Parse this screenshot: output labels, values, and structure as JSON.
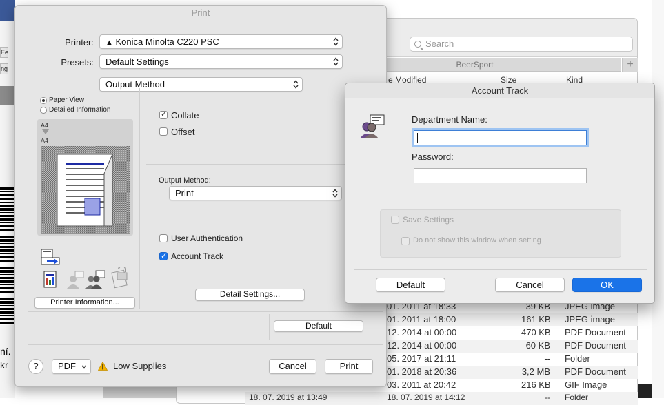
{
  "background": {
    "left_fragments": [
      "Ee",
      "ng",
      "ní.",
      "kr"
    ],
    "finder": {
      "search_placeholder": "Search",
      "folder_name": "BeerSport",
      "add_symbol": "+",
      "columns": [
        "e Modified",
        "Size",
        "Kind"
      ],
      "rows": [
        {
          "date": "01. 2011 at 18:33",
          "size": "39 KB",
          "kind": "JPEG image"
        },
        {
          "date": "01. 2011 at 18:00",
          "size": "161 KB",
          "kind": "JPEG image"
        },
        {
          "date": "12. 2014 at 00:00",
          "size": "470 KB",
          "kind": "PDF Document"
        },
        {
          "date": "12. 2014 at 00:00",
          "size": "60 KB",
          "kind": "PDF Document"
        },
        {
          "date": "05. 2017 at 21:11",
          "size": "--",
          "kind": "Folder"
        },
        {
          "date": "01. 2018 at 20:36",
          "size": "3,2 MB",
          "kind": "PDF Document"
        },
        {
          "date": "03. 2011 at 20:42",
          "size": "216 KB",
          "kind": "GIF Image"
        },
        {
          "date": "18. 07. 2019 at 14:12",
          "size": "--",
          "kind": "Folder"
        }
      ],
      "row_fragment_left": "18. 07. 2019 at 13:49"
    }
  },
  "print_dialog": {
    "title": "Print",
    "printer_label": "Printer:",
    "printer_value": "Konica Minolta C220 PSC",
    "printer_warning_glyph": "▲",
    "presets_label": "Presets:",
    "presets_value": "Default Settings",
    "section_value": "Output Method",
    "paper_view": "Paper View",
    "detailed_information": "Detailed Information",
    "preview_page_label_1": "A4",
    "preview_page_label_2": "A4",
    "printer_information_button": "Printer Information...",
    "collate": "Collate",
    "offset": "Offset",
    "output_method_label": "Output Method:",
    "output_method_value": "Print",
    "user_authentication": "User Authentication",
    "account_track": "Account Track",
    "detail_settings_button": "Detail Settings...",
    "default_button": "Default",
    "help_button": "?",
    "pdf_button": "PDF",
    "low_supplies": "Low Supplies",
    "cancel_button": "Cancel",
    "print_button": "Print",
    "collate_checked": true,
    "offset_checked": false,
    "user_authentication_checked": false,
    "account_track_checked": true
  },
  "account_track_dialog": {
    "title": "Account Track",
    "department_name_label": "Department Name:",
    "department_name_value": "",
    "password_label": "Password:",
    "password_value": "",
    "save_settings": "Save Settings",
    "do_not_show": "Do not show this window when setting",
    "default_button": "Default",
    "cancel_button": "Cancel",
    "ok_button": "OK"
  },
  "colors": {
    "accent": "#1a73e8",
    "dialog_bg": "#e6e6e6",
    "preview_bar_blue": "#1d2ba3"
  }
}
